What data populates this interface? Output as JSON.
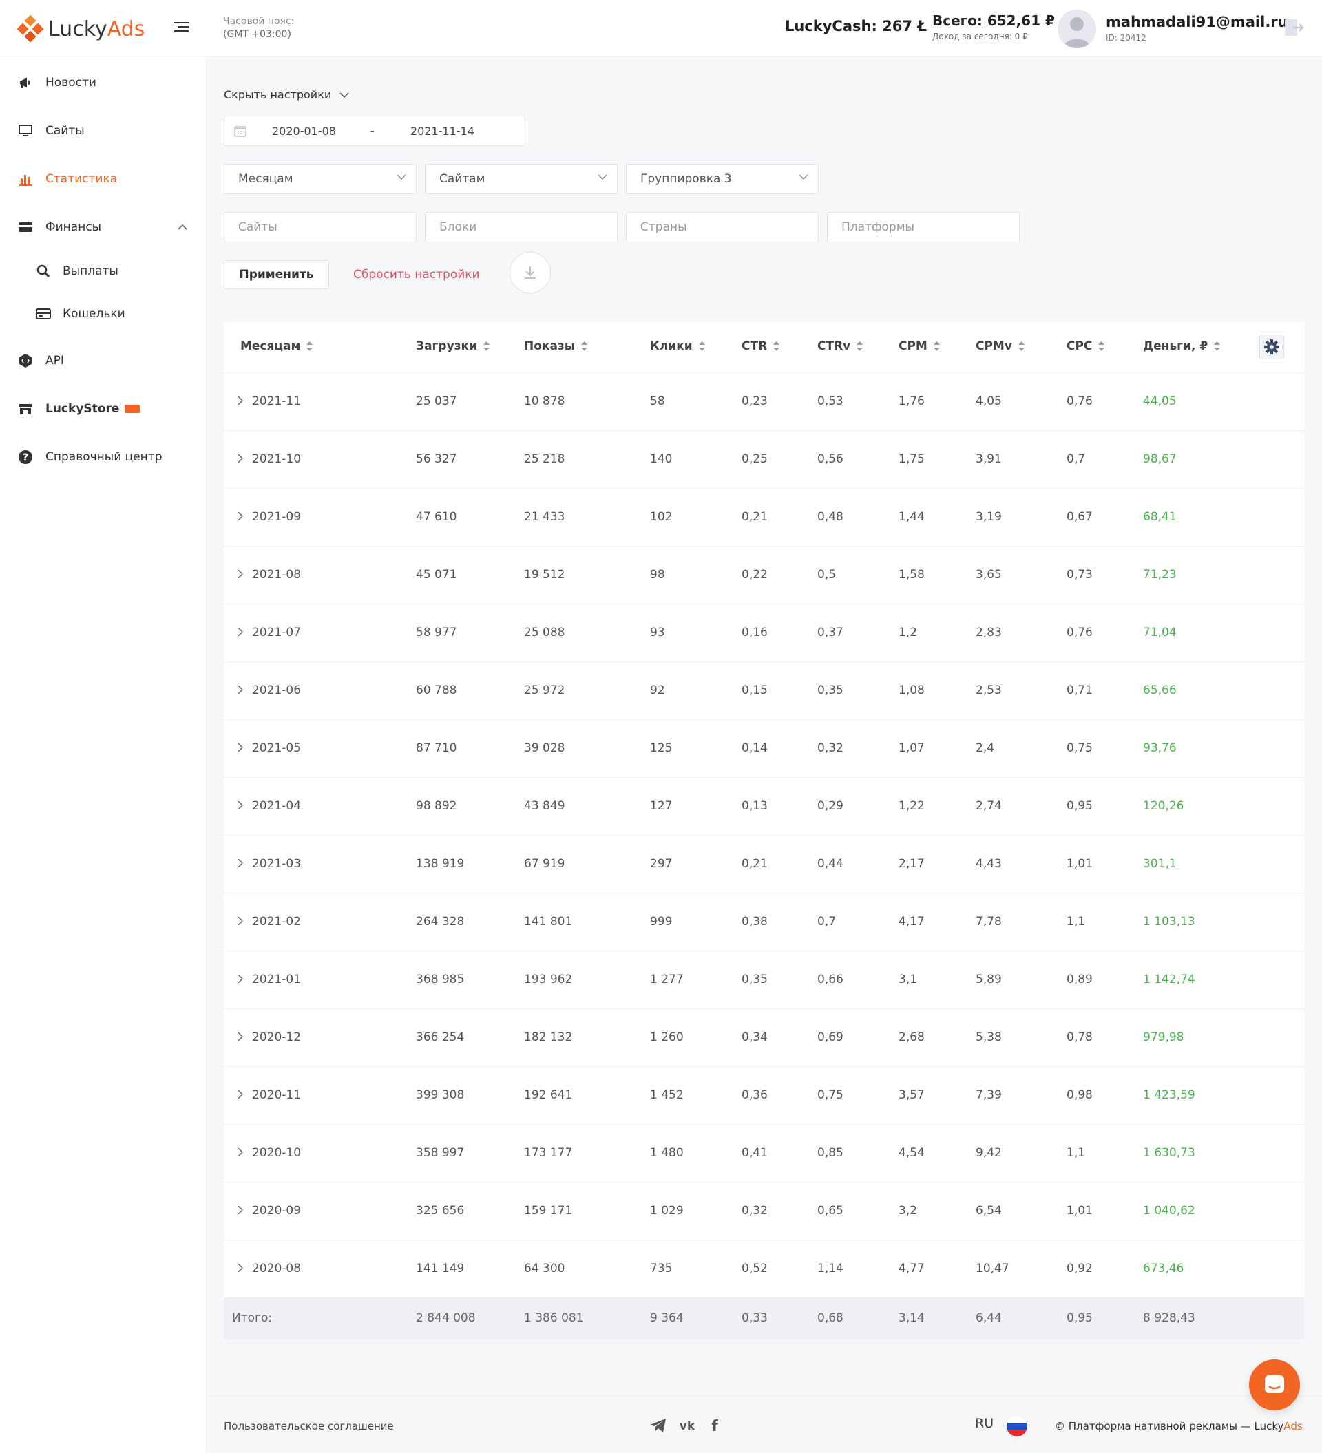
{
  "brand": {
    "name_part1": "Lucky",
    "name_part2": "Ads",
    "accent": "#f26522"
  },
  "header": {
    "timezone_label": "Часовой пояс:",
    "timezone_value": "(GMT +03:00)",
    "luckycash": "LuckyCash: 267 Ł",
    "total": "Всего: 652,61 ₽",
    "today": "Доход за сегодня: 0 ₽",
    "email": "mahmadali91@mail.ru",
    "user_id": "ID: 20412"
  },
  "sidebar": {
    "items": [
      {
        "label": "Новости",
        "icon": "megaphone-icon"
      },
      {
        "label": "Сайты",
        "icon": "monitor-icon"
      },
      {
        "label": "Статистика",
        "icon": "bar-chart-icon",
        "active": true
      },
      {
        "label": "Финансы",
        "icon": "card-icon",
        "expanded": true
      },
      {
        "label": "Выплаты",
        "icon": "search-money-icon"
      },
      {
        "label": "Кошельки",
        "icon": "wallet-icon"
      },
      {
        "label": "API",
        "icon": "api-icon"
      },
      {
        "label": "LuckyStore",
        "icon": "store-icon"
      },
      {
        "label": "Справочный центр",
        "icon": "help-icon"
      }
    ]
  },
  "filters": {
    "hide_settings": "Скрыть настройки",
    "date_from": "2020-01-08",
    "date_sep": "-",
    "date_to": "2021-11-14",
    "group1": "Месяцам",
    "group2": "Сайтам",
    "group3": "Группировка 3",
    "sites_placeholder": "Сайты",
    "blocks_placeholder": "Блоки",
    "countries_placeholder": "Страны",
    "platforms_placeholder": "Платформы",
    "apply": "Применить",
    "reset": "Сбросить настройки"
  },
  "table": {
    "columns": [
      "Месяцам",
      "Загрузки",
      "Показы",
      "Клики",
      "CTR",
      "CTRv",
      "CPM",
      "CPMv",
      "CPC",
      "Деньги, ₽"
    ],
    "rows": [
      [
        "2021-11",
        "25 037",
        "10 878",
        "58",
        "0,23",
        "0,53",
        "1,76",
        "4,05",
        "0,76",
        "44,05"
      ],
      [
        "2021-10",
        "56 327",
        "25 218",
        "140",
        "0,25",
        "0,56",
        "1,75",
        "3,91",
        "0,7",
        "98,67"
      ],
      [
        "2021-09",
        "47 610",
        "21 433",
        "102",
        "0,21",
        "0,48",
        "1,44",
        "3,19",
        "0,67",
        "68,41"
      ],
      [
        "2021-08",
        "45 071",
        "19 512",
        "98",
        "0,22",
        "0,5",
        "1,58",
        "3,65",
        "0,73",
        "71,23"
      ],
      [
        "2021-07",
        "58 977",
        "25 088",
        "93",
        "0,16",
        "0,37",
        "1,2",
        "2,83",
        "0,76",
        "71,04"
      ],
      [
        "2021-06",
        "60 788",
        "25 972",
        "92",
        "0,15",
        "0,35",
        "1,08",
        "2,53",
        "0,71",
        "65,66"
      ],
      [
        "2021-05",
        "87 710",
        "39 028",
        "125",
        "0,14",
        "0,32",
        "1,07",
        "2,4",
        "0,75",
        "93,76"
      ],
      [
        "2021-04",
        "98 892",
        "43 849",
        "127",
        "0,13",
        "0,29",
        "1,22",
        "2,74",
        "0,95",
        "120,26"
      ],
      [
        "2021-03",
        "138 919",
        "67 919",
        "297",
        "0,21",
        "0,44",
        "2,17",
        "4,43",
        "1,01",
        "301,1"
      ],
      [
        "2021-02",
        "264 328",
        "141 801",
        "999",
        "0,38",
        "0,7",
        "4,17",
        "7,78",
        "1,1",
        "1 103,13"
      ],
      [
        "2021-01",
        "368 985",
        "193 962",
        "1 277",
        "0,35",
        "0,66",
        "3,1",
        "5,89",
        "0,89",
        "1 142,74"
      ],
      [
        "2020-12",
        "366 254",
        "182 132",
        "1 260",
        "0,34",
        "0,69",
        "2,68",
        "5,38",
        "0,78",
        "979,98"
      ],
      [
        "2020-11",
        "399 308",
        "192 641",
        "1 452",
        "0,36",
        "0,75",
        "3,57",
        "7,39",
        "0,98",
        "1 423,59"
      ],
      [
        "2020-10",
        "358 997",
        "173 177",
        "1 480",
        "0,41",
        "0,85",
        "4,54",
        "9,42",
        "1,1",
        "1 630,73"
      ],
      [
        "2020-09",
        "325 656",
        "159 171",
        "1 029",
        "0,32",
        "0,65",
        "3,2",
        "6,54",
        "1,01",
        "1 040,62"
      ],
      [
        "2020-08",
        "141 149",
        "64 300",
        "735",
        "0,52",
        "1,14",
        "4,77",
        "10,47",
        "0,92",
        "673,46"
      ]
    ],
    "total": [
      "Итого:",
      "2 844 008",
      "1 386 081",
      "9 364",
      "0,33",
      "0,68",
      "3,14",
      "6,44",
      "0,95",
      "8 928,43"
    ]
  },
  "footer": {
    "agreement": "Пользовательское соглашение",
    "lang": "RU",
    "copyright_prefix": "© Платформа нативной рекламы — Lucky",
    "copyright_brand": "Ads"
  }
}
